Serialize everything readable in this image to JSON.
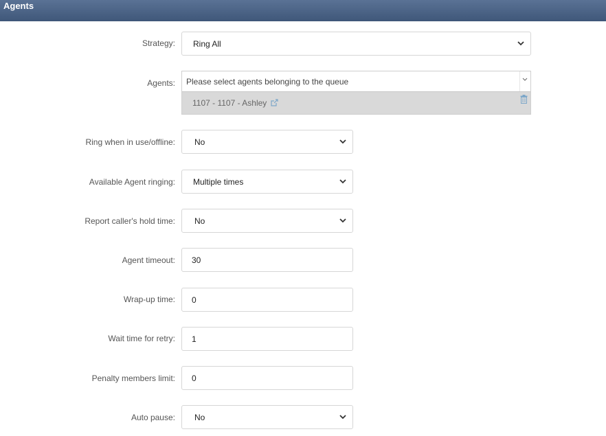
{
  "header": {
    "title": "Agents"
  },
  "form": {
    "strategy": {
      "label": "Strategy:",
      "value": "Ring All"
    },
    "agents": {
      "label": "Agents:",
      "placeholder": "Please select agents belonging to the queue",
      "selected": [
        {
          "text": "1107 - 1107 - Ashley"
        }
      ]
    },
    "ring_in_use": {
      "label": "Ring when in use/offline:",
      "value": "No"
    },
    "available_ringing": {
      "label": "Available Agent ringing:",
      "value": "Multiple times"
    },
    "report_hold": {
      "label": "Report caller's hold time:",
      "value": "No"
    },
    "agent_timeout": {
      "label": "Agent timeout:",
      "value": "30"
    },
    "wrapup_time": {
      "label": "Wrap-up time:",
      "value": "0"
    },
    "wait_retry": {
      "label": "Wait time for retry:",
      "value": "1"
    },
    "penalty_limit": {
      "label": "Penalty members limit:",
      "value": "0"
    },
    "auto_pause": {
      "label": "Auto pause:",
      "value": "No"
    }
  },
  "icons": {
    "chevron": "chevron-down-icon",
    "external": "external-link-icon",
    "trash": "trash-icon"
  },
  "colors": {
    "header_start": "#5a7295",
    "header_end": "#3f5779",
    "tag_bg": "#d9d9d9",
    "icon_blue": "#7da7c9"
  }
}
